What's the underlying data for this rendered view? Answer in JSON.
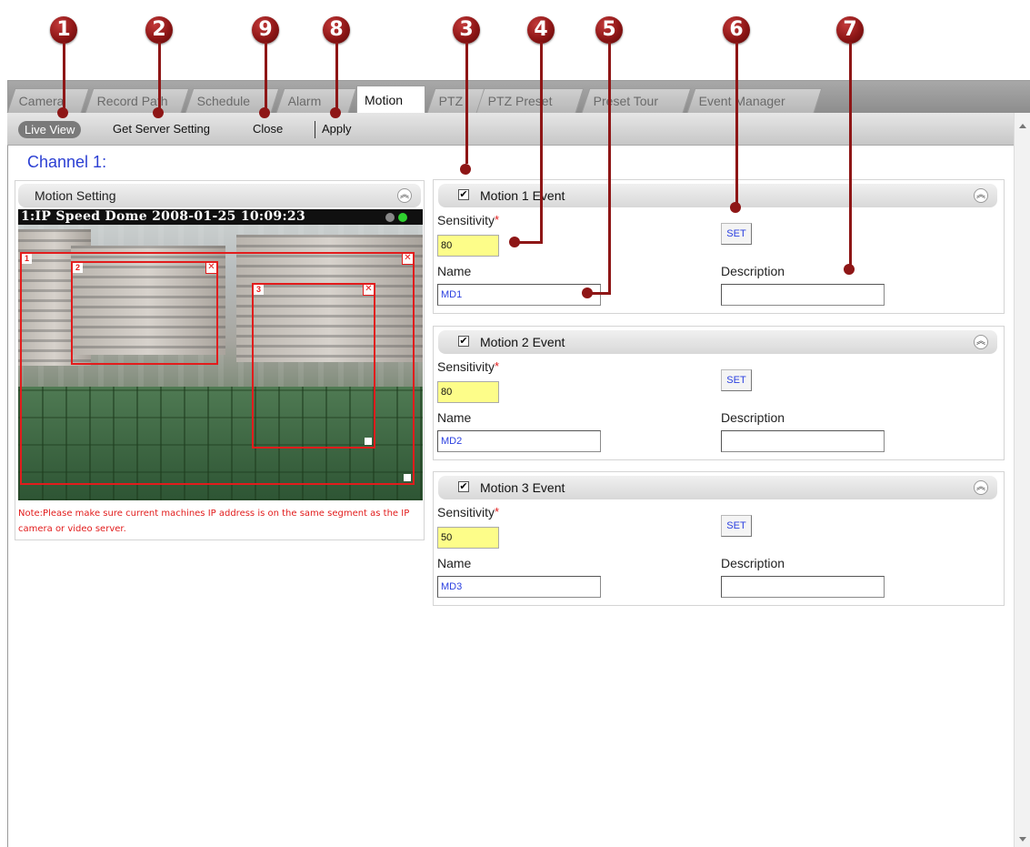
{
  "callouts": [
    "1",
    "2",
    "9",
    "8",
    "3",
    "4",
    "5",
    "6",
    "7"
  ],
  "tabs": [
    "Camera",
    "Record Path",
    "Schedule",
    "Alarm",
    "Motion",
    "PTZ",
    "PTZ Preset",
    "Preset Tour",
    "Event Manager"
  ],
  "active_tab": "Motion",
  "toolbar": {
    "live_view": "Live View",
    "get_server_setting": "Get Server Setting",
    "close": "Close",
    "apply": "Apply"
  },
  "channel_title": "Channel 1:",
  "motion_setting": {
    "header": "Motion Setting",
    "video_overlay": "1:IP Speed Dome   2008-01-25 10:09:23",
    "region_labels": [
      "1",
      "2",
      "3"
    ],
    "note": "Note:Please make sure current machines IP address is on the same segment as the IP camera or video server."
  },
  "events": [
    {
      "title": "Motion 1 Event",
      "enabled": true,
      "sensitivity_label": "Sensitivity",
      "sensitivity": "80",
      "set_label": "SET",
      "name_label": "Name",
      "name": "MD1",
      "description_label": "Description",
      "description": ""
    },
    {
      "title": "Motion 2 Event",
      "enabled": true,
      "sensitivity_label": "Sensitivity",
      "sensitivity": "80",
      "set_label": "SET",
      "name_label": "Name",
      "name": "MD2",
      "description_label": "Description",
      "description": ""
    },
    {
      "title": "Motion 3 Event",
      "enabled": true,
      "sensitivity_label": "Sensitivity",
      "sensitivity": "50",
      "set_label": "SET",
      "name_label": "Name",
      "name": "MD3",
      "description_label": "Description",
      "description": ""
    }
  ],
  "check_mark": "✔",
  "required_mark": "*",
  "colors": {
    "accent_blue": "#2b3fd3",
    "callout_red": "#8e1616",
    "region_red": "#e21c1c",
    "sensitivity_yellow": "#fdfd89"
  },
  "icons": {
    "collapse": "double-chevron-up-icon",
    "close_region": "close-icon",
    "checkbox": "checkbox-checked-icon"
  }
}
